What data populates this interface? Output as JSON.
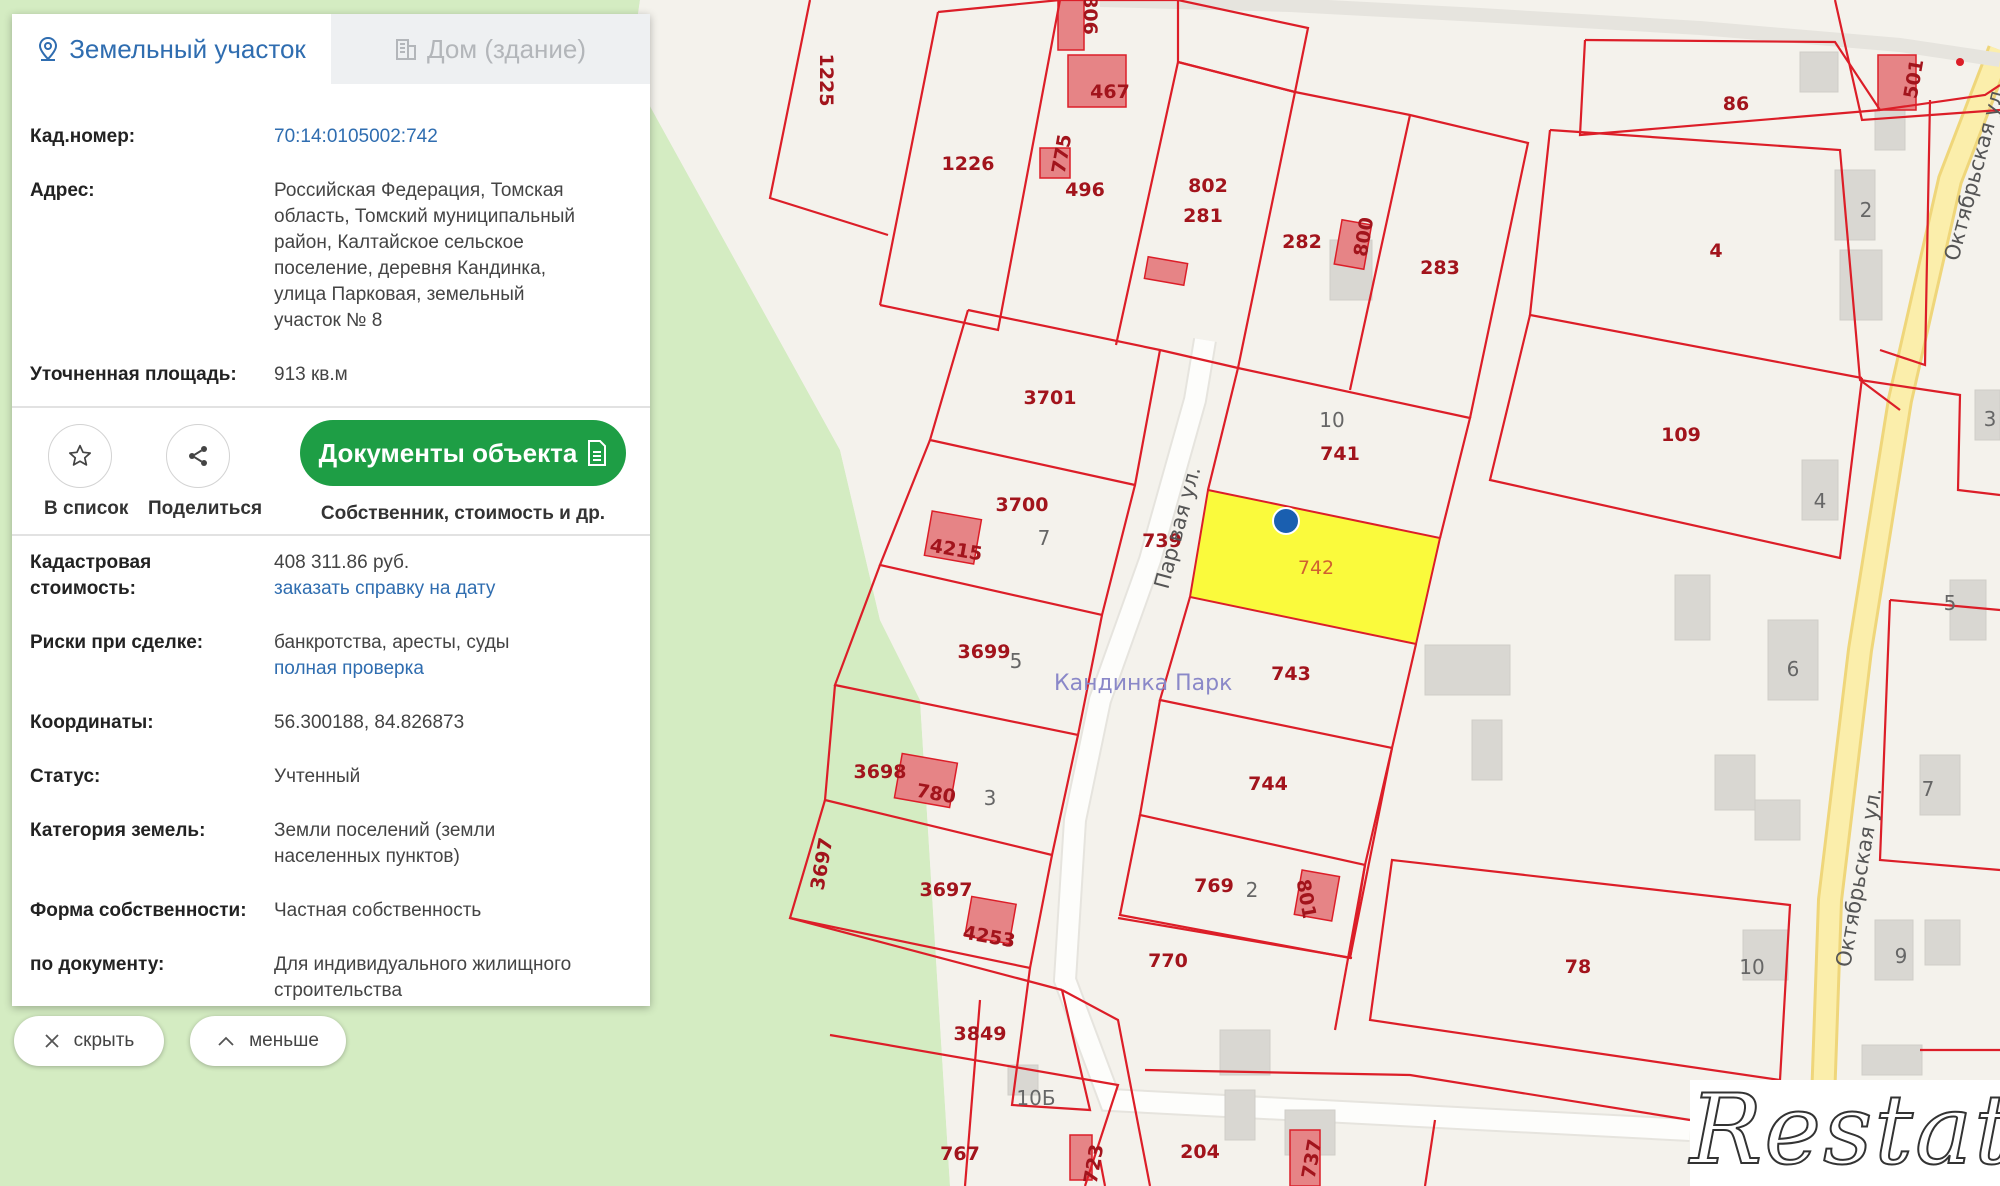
{
  "tabs": {
    "land": "Земельный участок",
    "building": "Дом (здание)"
  },
  "info": {
    "cad_label": "Кад.номер:",
    "cad_value": "70:14:0105002:742",
    "address_label": "Адрес:",
    "address_lines": [
      "Российская Федерация, Томская",
      "область, Томский муниципальный",
      "район, Калтайское сельское",
      "поселение, деревня Кандинка,",
      "улица Парковая, земельный",
      "участок № 8"
    ],
    "area_label": "Уточненная площадь:",
    "area_value": "913 кв.м"
  },
  "actions": {
    "list_label": "В список",
    "share_label": "Поделиться",
    "docs_button": "Документы объекта",
    "docs_sub": "Собственник, стоимость и др."
  },
  "details": {
    "cost_label": [
      "Кадастровая",
      "стоимость:"
    ],
    "cost_value": "408 311.86 руб.",
    "cost_link": "заказать справку на дату",
    "risk_label": "Риски при сделке:",
    "risk_value": "банкротства, аресты, суды",
    "risk_link": "полная проверка",
    "coord_label": "Координаты:",
    "coord_value": "56.300188, 84.826873",
    "status_label": "Статус:",
    "status_value": "Учтенный",
    "category_label": "Категория земель:",
    "category_lines": [
      "Земли поселений (земли",
      "населенных пунктов)"
    ],
    "ownership_label": "Форма собственности:",
    "ownership_value": "Частная собственность",
    "doc_label": "по документу:",
    "doc_lines": [
      "Для индивидуального жилищного",
      "строительства"
    ]
  },
  "bottom_buttons": {
    "hide": "скрыть",
    "less": "меньше"
  },
  "map": {
    "plot_labels": [
      "1225",
      "1226",
      "496",
      "775",
      "467",
      "806",
      "802",
      "281",
      "282",
      "800",
      "283",
      "86",
      "501",
      "4",
      "3701",
      "10",
      "741",
      "109",
      "3700",
      "7",
      "4215",
      "739",
      "742",
      "3699",
      "5",
      "743",
      "Кандинка Парк",
      "3698",
      "780",
      "3",
      "744",
      "3697",
      "3697",
      "4253",
      "769",
      "2",
      "801",
      "770",
      "78",
      "3849",
      "10Б",
      "767",
      "723",
      "204",
      "737"
    ],
    "house_numbers": [
      "2",
      "4",
      "5",
      "6",
      "7",
      "9",
      "10",
      "3"
    ],
    "streets": [
      "Пар вая ул.",
      "Октябрьская ул.",
      "Октябрьская ул."
    ]
  },
  "watermark": "Restate",
  "colors": {
    "accent": "#2f6db0",
    "button_green": "#1e9e45",
    "parcel_border": "#dc1e28",
    "selected_parcel": "#fafa3c",
    "green_area": "#d4ecc2"
  }
}
